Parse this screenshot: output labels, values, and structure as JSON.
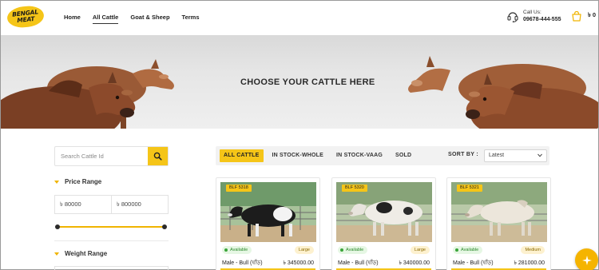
{
  "brand": {
    "logo_line1": "BENGAL",
    "logo_line2": "MEAT"
  },
  "nav": {
    "items": [
      "Home",
      "All Cattle",
      "Goat & Sheep",
      "Terms"
    ],
    "active": "All Cattle"
  },
  "contact": {
    "label": "Call Us:",
    "phone": "09678-444-555",
    "icon": "headset-icon"
  },
  "cart": {
    "count": "৳ 0",
    "icon": "shopping-bag-icon"
  },
  "banner": {
    "title": "CHOOSE YOUR CATTLE HERE"
  },
  "sidebar": {
    "search": {
      "placeholder": "Search Cattle Id",
      "icon": "search-icon"
    },
    "price_range": {
      "title": "Price Range",
      "min": "৳ 80000",
      "max": "৳ 800000"
    },
    "weight_range": {
      "title": "Weight Range"
    }
  },
  "filters": {
    "tabs": [
      "ALL CATTLE",
      "IN STOCK-WHOLE",
      "IN STOCK-VAAG",
      "SOLD"
    ],
    "active": "ALL CATTLE",
    "sort_label": "SORT BY :",
    "sort_value": "Latest"
  },
  "cards": [
    {
      "code": "BLF 5318",
      "status": "Available",
      "size": "Large",
      "title": "Male - Bull (ষাঁড়)",
      "price": "৳ 345000.00"
    },
    {
      "code": "BLF 5320",
      "status": "Available",
      "size": "Large",
      "title": "Male - Bull (ষাঁড়)",
      "price": "৳ 340000.00"
    },
    {
      "code": "BLF 5321",
      "status": "Available",
      "size": "Medium",
      "title": "Male - Bull (ষাঁড়)",
      "price": "৳ 281000.00"
    }
  ],
  "colors": {
    "accent": "#f5c518",
    "available": "#3aa53a"
  }
}
